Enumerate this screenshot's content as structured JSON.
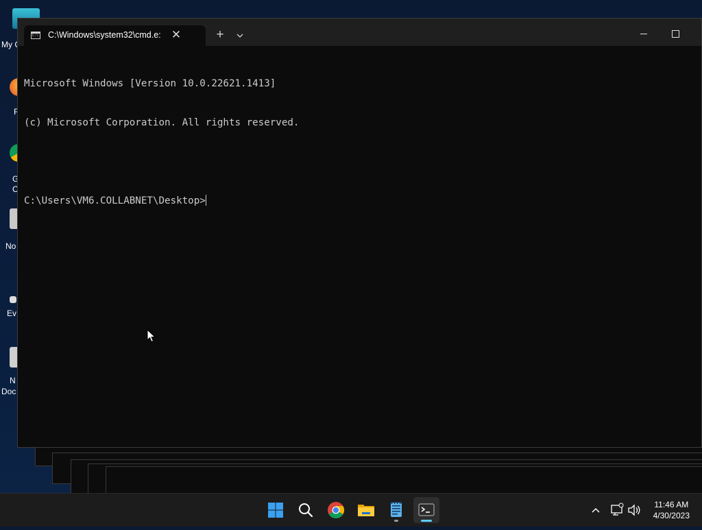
{
  "desktop": {
    "icons": [
      {
        "label": "My C"
      },
      {
        "label": "F"
      },
      {
        "label": "G"
      },
      {
        "label": "C"
      },
      {
        "label": "No"
      },
      {
        "label": "Ev"
      },
      {
        "label": "N"
      },
      {
        "label": "Doc"
      }
    ]
  },
  "terminal": {
    "tab_title": "C:\\Windows\\system32\\cmd.e:",
    "tab_icon_text": "C:\\",
    "console_lines": [
      "Microsoft Windows [Version 10.0.22621.1413]",
      "(c) Microsoft Corporation. All rights reserved.",
      "",
      "C:\\Users\\VM6.COLLABNET\\Desktop>"
    ]
  },
  "taskbar": {
    "apps": [
      {
        "name": "start",
        "icon": "windows-logo-icon"
      },
      {
        "name": "search",
        "icon": "search-icon"
      },
      {
        "name": "chrome",
        "icon": "chrome-icon"
      },
      {
        "name": "file-explorer",
        "icon": "folder-icon"
      },
      {
        "name": "notepad",
        "icon": "notepad-icon"
      },
      {
        "name": "terminal",
        "icon": "terminal-icon"
      }
    ],
    "clock": {
      "time": "11:46 AM",
      "date": "4/30/2023"
    }
  },
  "colors": {
    "accent": "#60cdff",
    "console_bg": "#0c0c0c",
    "console_text": "#cccccc"
  }
}
